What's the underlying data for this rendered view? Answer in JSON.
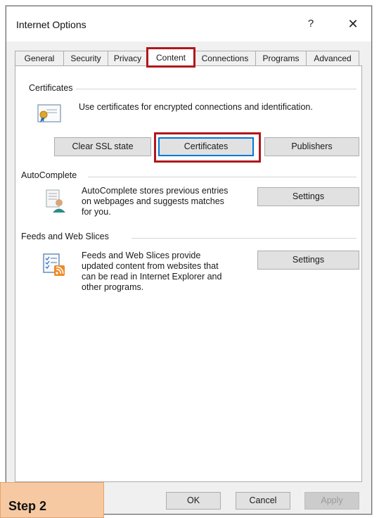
{
  "window": {
    "title": "Internet Options",
    "help_label": "?",
    "close_label": "✕"
  },
  "tabs": [
    {
      "label": "General",
      "active": false
    },
    {
      "label": "Security",
      "active": false
    },
    {
      "label": "Privacy",
      "active": false
    },
    {
      "label": "Content",
      "active": true
    },
    {
      "label": "Connections",
      "active": false
    },
    {
      "label": "Programs",
      "active": false
    },
    {
      "label": "Advanced",
      "active": false
    }
  ],
  "certificates": {
    "group_label": "Certificates",
    "description": "Use certificates for encrypted connections and identification.",
    "icon": "certificate-icon",
    "clear_ssl_label": "Clear SSL state",
    "certificates_label": "Certificates",
    "publishers_label": "Publishers"
  },
  "autocomplete": {
    "group_label": "AutoComplete",
    "description_lines": [
      "AutoComplete stores previous entries",
      "on webpages and suggests matches",
      "for you."
    ],
    "icon": "autocomplete-icon",
    "settings_label": "Settings"
  },
  "feeds": {
    "group_label": "Feeds and Web Slices",
    "description_lines": [
      "Feeds and Web Slices provide",
      "updated content from websites that",
      "can be read in Internet Explorer and",
      "other programs."
    ],
    "icon": "feeds-icon",
    "settings_label": "Settings"
  },
  "footer": {
    "ok_label": "OK",
    "cancel_label": "Cancel",
    "apply_label": "Apply"
  },
  "annotation": {
    "step_label": "Step 2"
  },
  "colors": {
    "highlight": "#b0171c",
    "focus": "#0078d7",
    "badge": "#f6c9a3"
  }
}
